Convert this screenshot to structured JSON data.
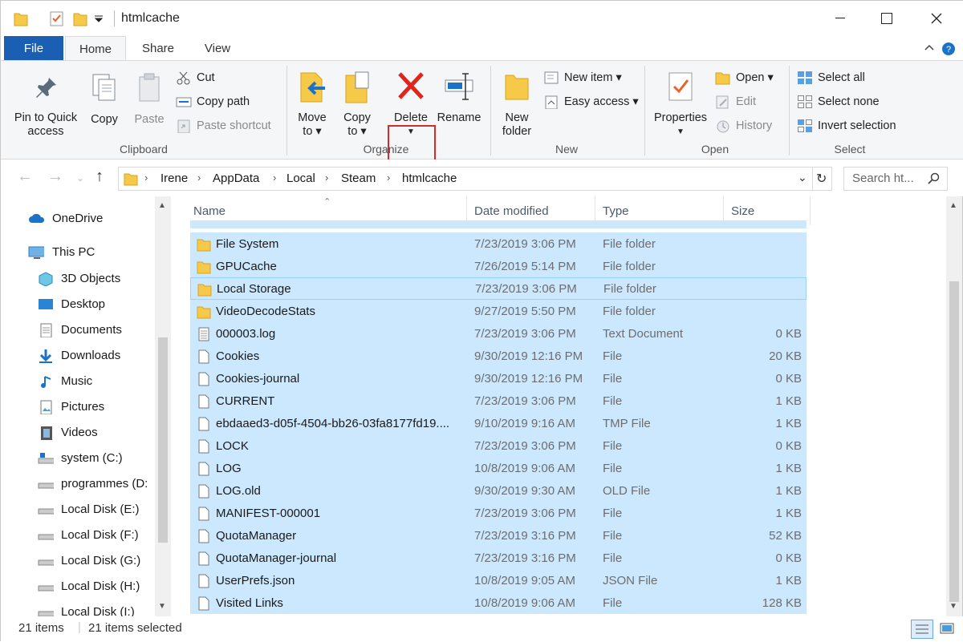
{
  "window": {
    "title": "htmlcache",
    "controls": [
      "minimize",
      "maximize",
      "close"
    ]
  },
  "ribbon_tabs": [
    {
      "label": "File"
    },
    {
      "label": "Home"
    },
    {
      "label": "Share"
    },
    {
      "label": "View"
    }
  ],
  "ribbon": {
    "clipboard": {
      "group_label": "Clipboard",
      "pin_label_1": "Pin to Quick",
      "pin_label_2": "access",
      "copy_label": "Copy",
      "paste_label": "Paste",
      "cut_label": "Cut",
      "copy_path_label": "Copy path",
      "paste_shortcut_label": "Paste shortcut"
    },
    "organize": {
      "group_label": "Organize",
      "move_label_1": "Move",
      "move_label_2": "to",
      "copy_label_1": "Copy",
      "copy_label_2": "to",
      "delete_label": "Delete",
      "rename_label": "Rename"
    },
    "new": {
      "group_label": "New",
      "new_folder_1": "New",
      "new_folder_2": "folder",
      "new_item_label": "New item",
      "easy_access_label": "Easy access"
    },
    "open": {
      "group_label": "Open",
      "properties_label": "Properties",
      "open_label": "Open",
      "edit_label": "Edit",
      "history_label": "History"
    },
    "select": {
      "group_label": "Select",
      "select_all_label": "Select all",
      "select_none_label": "Select none",
      "invert_label": "Invert selection"
    }
  },
  "address": {
    "breadcrumbs": [
      "Irene",
      "AppData",
      "Local",
      "Steam",
      "htmlcache"
    ],
    "search_placeholder": "Search ht..."
  },
  "nav_pane": [
    {
      "label": "OneDrive",
      "icon": "cloud-icon"
    },
    {
      "label": "This PC",
      "icon": "pc-icon"
    },
    {
      "label": "3D Objects",
      "icon": "cube-icon"
    },
    {
      "label": "Desktop",
      "icon": "desktop-icon"
    },
    {
      "label": "Documents",
      "icon": "document-icon"
    },
    {
      "label": "Downloads",
      "icon": "download-icon"
    },
    {
      "label": "Music",
      "icon": "music-icon"
    },
    {
      "label": "Pictures",
      "icon": "pictures-icon"
    },
    {
      "label": "Videos",
      "icon": "video-icon"
    },
    {
      "label": "system (C:)",
      "icon": "system-drive-icon"
    },
    {
      "label": "programmes (D:",
      "icon": "drive-icon"
    },
    {
      "label": "Local Disk (E:)",
      "icon": "drive-icon"
    },
    {
      "label": "Local Disk (F:)",
      "icon": "drive-icon"
    },
    {
      "label": "Local Disk (G:)",
      "icon": "drive-icon"
    },
    {
      "label": "Local Disk (H:)",
      "icon": "drive-icon"
    },
    {
      "label": "Local Disk (I:)",
      "icon": "drive-icon"
    }
  ],
  "columns": {
    "name": "Name",
    "date": "Date modified",
    "type": "Type",
    "size": "Size"
  },
  "files": [
    {
      "name": "File System",
      "date": "7/23/2019 3:06 PM",
      "type": "File folder",
      "size": "",
      "kind": "folder"
    },
    {
      "name": "GPUCache",
      "date": "7/26/2019 5:14 PM",
      "type": "File folder",
      "size": "",
      "kind": "folder"
    },
    {
      "name": "Local Storage",
      "date": "7/23/2019 3:06 PM",
      "type": "File folder",
      "size": "",
      "kind": "folder"
    },
    {
      "name": "VideoDecodeStats",
      "date": "9/27/2019 5:50 PM",
      "type": "File folder",
      "size": "",
      "kind": "folder"
    },
    {
      "name": "000003.log",
      "date": "7/23/2019 3:06 PM",
      "type": "Text Document",
      "size": "0 KB",
      "kind": "text"
    },
    {
      "name": "Cookies",
      "date": "9/30/2019 12:16 PM",
      "type": "File",
      "size": "20 KB",
      "kind": "file"
    },
    {
      "name": "Cookies-journal",
      "date": "9/30/2019 12:16 PM",
      "type": "File",
      "size": "0 KB",
      "kind": "file"
    },
    {
      "name": "CURRENT",
      "date": "7/23/2019 3:06 PM",
      "type": "File",
      "size": "1 KB",
      "kind": "file"
    },
    {
      "name": "ebdaaed3-d05f-4504-bb26-03fa8177fd19....",
      "date": "9/10/2019 9:16 AM",
      "type": "TMP File",
      "size": "1 KB",
      "kind": "file"
    },
    {
      "name": "LOCK",
      "date": "7/23/2019 3:06 PM",
      "type": "File",
      "size": "0 KB",
      "kind": "file"
    },
    {
      "name": "LOG",
      "date": "10/8/2019 9:06 AM",
      "type": "File",
      "size": "1 KB",
      "kind": "file"
    },
    {
      "name": "LOG.old",
      "date": "9/30/2019 9:30 AM",
      "type": "OLD File",
      "size": "1 KB",
      "kind": "file"
    },
    {
      "name": "MANIFEST-000001",
      "date": "7/23/2019 3:06 PM",
      "type": "File",
      "size": "1 KB",
      "kind": "file"
    },
    {
      "name": "QuotaManager",
      "date": "7/23/2019 3:16 PM",
      "type": "File",
      "size": "52 KB",
      "kind": "file"
    },
    {
      "name": "QuotaManager-journal",
      "date": "7/23/2019 3:16 PM",
      "type": "File",
      "size": "0 KB",
      "kind": "file"
    },
    {
      "name": "UserPrefs.json",
      "date": "10/8/2019 9:05 AM",
      "type": "JSON File",
      "size": "1 KB",
      "kind": "file"
    },
    {
      "name": "Visited Links",
      "date": "10/8/2019 9:06 AM",
      "type": "File",
      "size": "128 KB",
      "kind": "file"
    }
  ],
  "status": {
    "item_count": "21 items",
    "selected_count": "21 items selected"
  },
  "colors": {
    "selection": "#cce8ff",
    "file_tab": "#1a5fb4",
    "delete_highlight": "#d42c2c",
    "folder_yellow": "#f7c948"
  }
}
